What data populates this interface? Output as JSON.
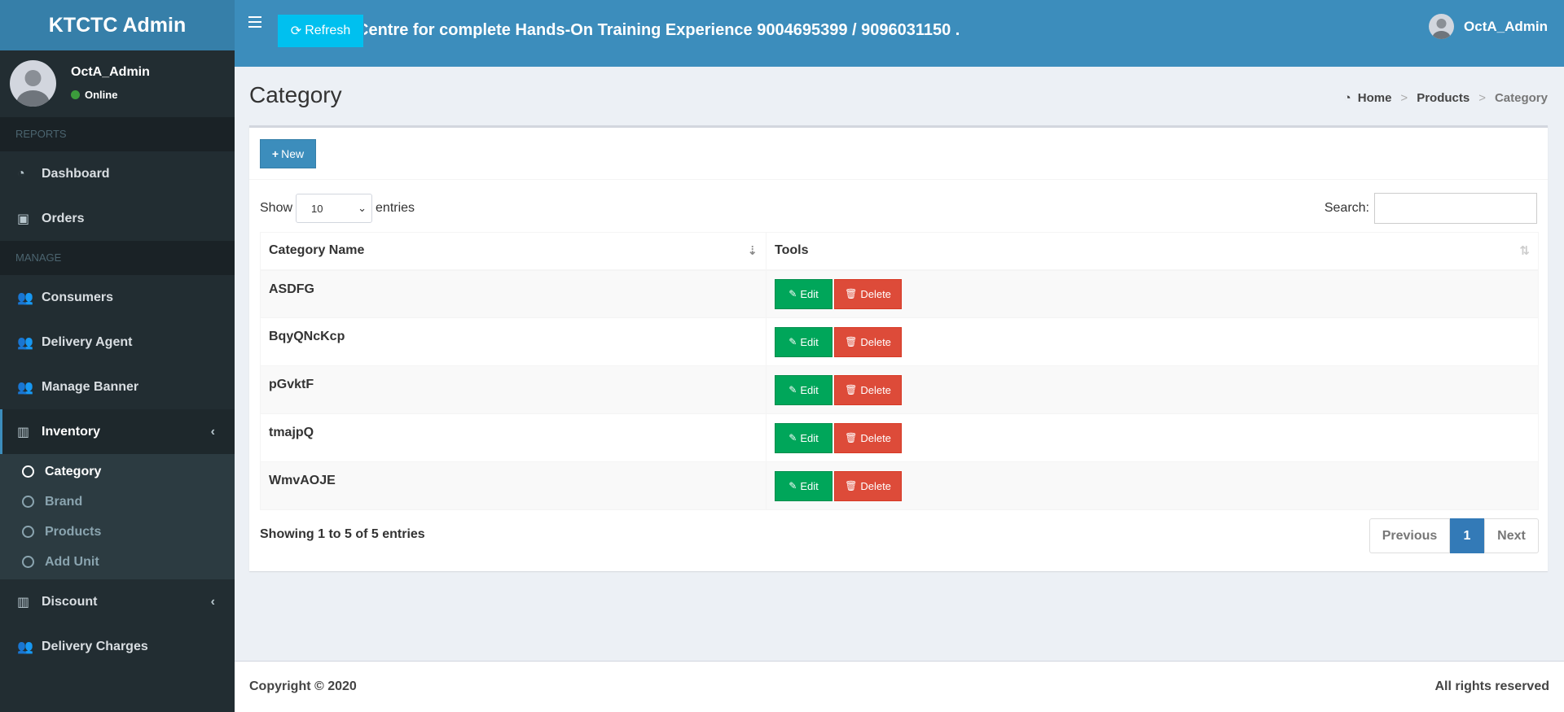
{
  "brand": "KTCTC Admin",
  "user": {
    "name": "OctA_Admin",
    "status": "Online"
  },
  "sidebar": {
    "reports_header": "REPORTS",
    "manage_header": "MANAGE",
    "items": [
      {
        "label": "Dashboard",
        "icon": "dashboard-icon"
      },
      {
        "label": "Orders",
        "icon": "money-icon"
      },
      {
        "label": "Consumers",
        "icon": "users-icon"
      },
      {
        "label": "Delivery Agent",
        "icon": "users-icon"
      },
      {
        "label": "Manage Banner",
        "icon": "users-icon"
      },
      {
        "label": "Inventory",
        "icon": "barcode-icon"
      },
      {
        "label": "Discount",
        "icon": "barcode-icon"
      },
      {
        "label": "Delivery Charges",
        "icon": "users-icon"
      }
    ],
    "inventory_sub": [
      "Category",
      "Brand",
      "Products",
      "Add Unit"
    ]
  },
  "topbar": {
    "refresh_label": "Refresh",
    "marquee": "Centre for complete Hands-On Training Experience 9004695399 / 9096031150 ."
  },
  "page": {
    "title": "Category",
    "breadcrumb": [
      "Home",
      "Products",
      "Category"
    ]
  },
  "box": {
    "new_label": "New",
    "show_label": "Show",
    "entries_value": "10",
    "entries_label": "entries",
    "search_label": "Search:",
    "search_value": "",
    "columns": [
      "Category Name",
      "Tools"
    ],
    "rows": [
      "ASDFG",
      "BqyQNcKcp",
      "pGvktF",
      "tmajpQ",
      "WmvAOJE"
    ],
    "edit_label": "Edit",
    "delete_label": "Delete",
    "info": "Showing 1 to 5 of 5 entries",
    "pager": {
      "prev": "Previous",
      "current": "1",
      "next": "Next"
    }
  },
  "footer": {
    "copyright": "Copyright © 2020",
    "rights": "All rights reserved"
  },
  "colors": {
    "primary": "#3c8dbc",
    "sidebar": "#222d32",
    "success": "#00a65a",
    "danger": "#dd4b39",
    "info": "#00c0ef"
  }
}
